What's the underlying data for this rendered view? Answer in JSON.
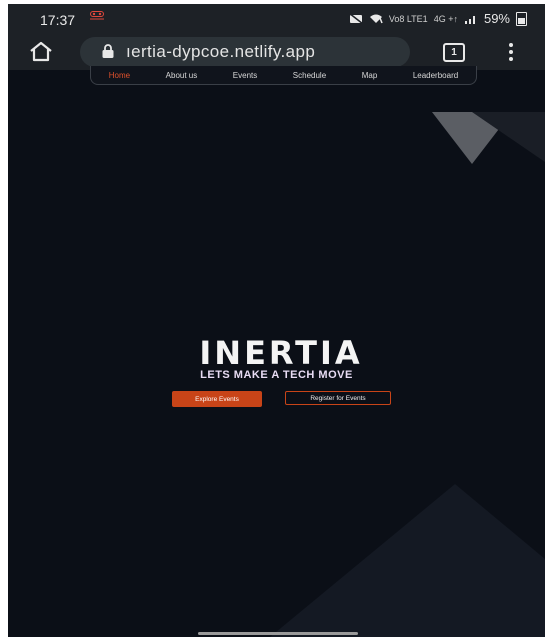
{
  "status_bar": {
    "time": "17:37",
    "battery": "59%",
    "network_labels": [
      "Vo8 LTE1",
      "4G +↑"
    ]
  },
  "browser": {
    "url": "ıertia-dypcoe.netlify.app",
    "tab_count": "1"
  },
  "site_nav": {
    "items": [
      {
        "label": "Home",
        "active": true
      },
      {
        "label": "About us",
        "active": false
      },
      {
        "label": "Events",
        "active": false
      },
      {
        "label": "Schedule",
        "active": false
      },
      {
        "label": "Map",
        "active": false
      },
      {
        "label": "Leaderboard",
        "active": false
      }
    ]
  },
  "hero": {
    "logo_text": "INERTIA",
    "tagline": "LETS MAKE A TECH MOVE",
    "explore_label": "Explore Events",
    "register_label": "Register for Events"
  },
  "colors": {
    "background": "#0b0f17",
    "accent": "#c84418",
    "nav_active": "#e0512c",
    "tagline": "#e8dcf4"
  }
}
